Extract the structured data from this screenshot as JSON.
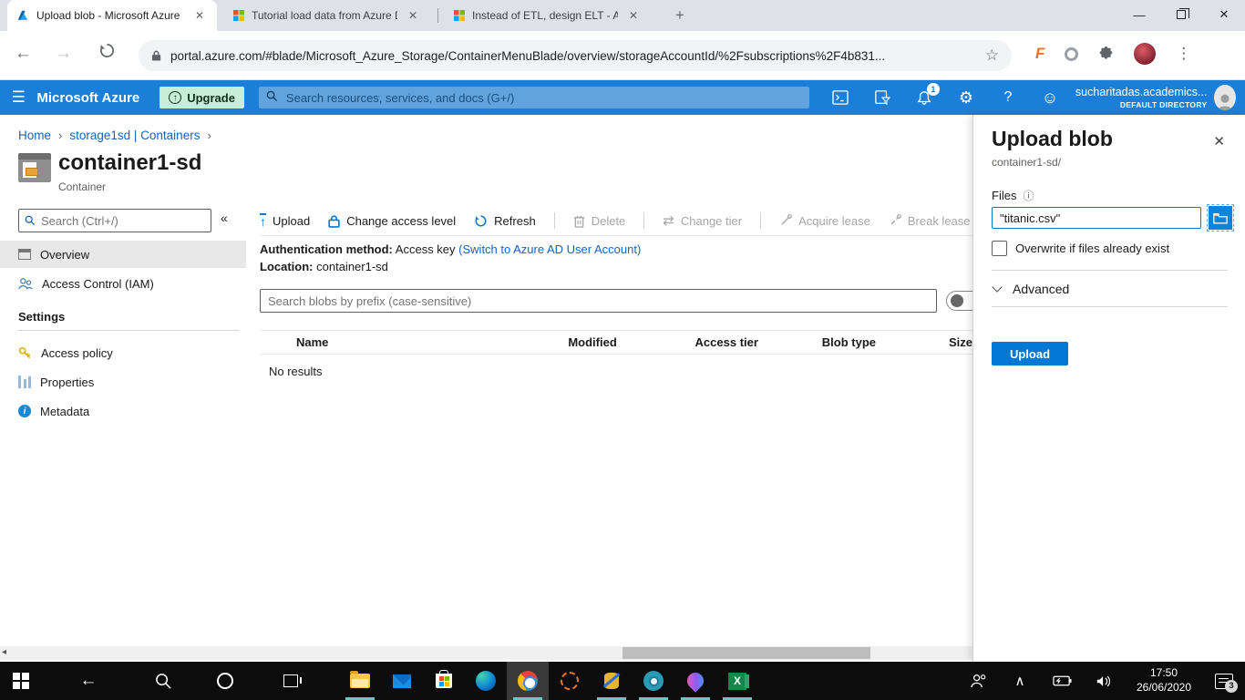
{
  "glyphs": {
    "back": "←",
    "forward": "→",
    "star": "☆",
    "menu_dots": "⋮",
    "new_tab": "+",
    "close": "✕",
    "minimize": "—",
    "hamburger": "☰",
    "collapse": "«",
    "breadcrumb_sep": "›",
    "gear": "⚙",
    "help": "?",
    "smiley": "☺",
    "info": "ⓘ",
    "change_tier": "⇄",
    "chevron_up": "∧",
    "scroll_left": "◂",
    "upload_arrow": "↑",
    "ext_f": "F"
  },
  "browser": {
    "tabs": [
      {
        "title": "Upload blob - Microsoft Azure"
      },
      {
        "title": "Tutorial load data from Azure D"
      },
      {
        "title": "Instead of ETL, design ELT - Azu"
      }
    ],
    "url": "portal.azure.com/#blade/Microsoft_Azure_Storage/ContainerMenuBlade/overview/storageAccountId/%2Fsubscriptions%2F4b831..."
  },
  "azure_header": {
    "brand": "Microsoft Azure",
    "upgrade_label": "Upgrade",
    "search_placeholder": "Search resources, services, and docs (G+/)",
    "notification_count": "1",
    "account_name": "sucharitadas.academics...",
    "account_directory": "DEFAULT DIRECTORY"
  },
  "breadcrumb": {
    "items": [
      "Home",
      "storage1sd | Containers"
    ]
  },
  "page": {
    "title": "container1-sd",
    "subtitle": "Container"
  },
  "sidebar": {
    "search_placeholder": "Search (Ctrl+/)",
    "items": [
      {
        "label": "Overview"
      },
      {
        "label": "Access Control (IAM)"
      }
    ],
    "section_label": "Settings",
    "settings_items": [
      "Access policy",
      "Properties",
      "Metadata"
    ]
  },
  "toolbar": {
    "items": [
      {
        "label": "Upload"
      },
      {
        "label": "Change access level"
      },
      {
        "label": "Refresh"
      },
      {
        "label": "Delete"
      },
      {
        "label": "Change tier"
      },
      {
        "label": "Acquire lease"
      },
      {
        "label": "Break lease"
      }
    ]
  },
  "overview": {
    "auth_label": "Authentication method:",
    "auth_value": "Access key",
    "auth_link": "(Switch to Azure AD User Account)",
    "location_label": "Location:",
    "location_value": "container1-sd",
    "search_placeholder": "Search blobs by prefix (case-sensitive)",
    "table_headers": [
      "Name",
      "Modified",
      "Access tier",
      "Blob type",
      "Size"
    ],
    "empty_text": "No results"
  },
  "upload_panel": {
    "title": "Upload blob",
    "subtitle": "container1-sd/",
    "files_label": "Files",
    "file_value": "\"titanic.csv\"",
    "overwrite_label": "Overwrite if files already exist",
    "advanced_label": "Advanced",
    "upload_button": "Upload"
  },
  "taskbar": {
    "time": "17:50",
    "date": "26/06/2020",
    "notification_count": "3"
  }
}
